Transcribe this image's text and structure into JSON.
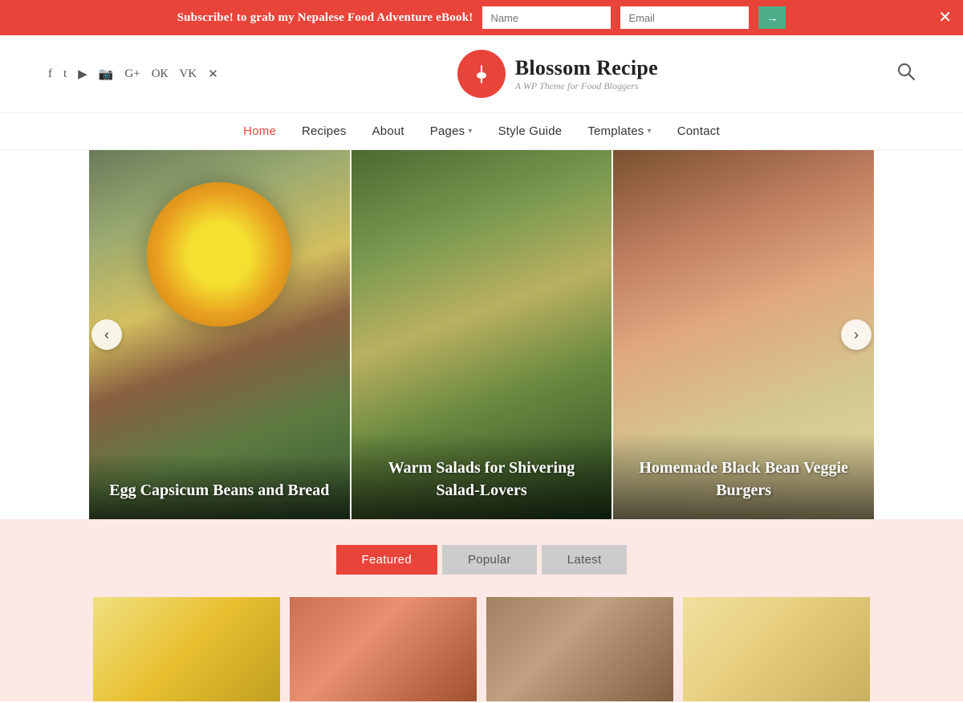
{
  "topBanner": {
    "text": "Subscribe! to grab my Nepalese Food Adventure eBook!",
    "namePlaceholder": "Name",
    "emailPlaceholder": "Email",
    "submitArrow": "→",
    "closeIcon": "✕"
  },
  "header": {
    "logoIcon": "🍴",
    "siteTitle": "Blossom Recipe",
    "siteTagline": "A WP Theme for Food Bloggers",
    "searchIcon": "🔍",
    "socialIcons": [
      {
        "name": "facebook-icon",
        "symbol": "f"
      },
      {
        "name": "twitter-icon",
        "symbol": "t"
      },
      {
        "name": "youtube-icon",
        "symbol": "▶"
      },
      {
        "name": "instagram-icon",
        "symbol": "📷"
      },
      {
        "name": "googleplus-icon",
        "symbol": "G+"
      },
      {
        "name": "odnoklassniki-icon",
        "symbol": "ОК"
      },
      {
        "name": "vk-icon",
        "symbol": "VK"
      },
      {
        "name": "xing-icon",
        "symbol": "✕"
      }
    ]
  },
  "nav": {
    "items": [
      {
        "label": "Home",
        "active": true,
        "hasDropdown": false
      },
      {
        "label": "Recipes",
        "active": false,
        "hasDropdown": false
      },
      {
        "label": "About",
        "active": false,
        "hasDropdown": false
      },
      {
        "label": "Pages",
        "active": false,
        "hasDropdown": true
      },
      {
        "label": "Style Guide",
        "active": false,
        "hasDropdown": false
      },
      {
        "label": "Templates",
        "active": false,
        "hasDropdown": true
      },
      {
        "label": "Contact",
        "active": false,
        "hasDropdown": false
      }
    ]
  },
  "carousel": {
    "prevIcon": "‹",
    "nextIcon": "›",
    "slides": [
      {
        "title": "Egg Capsicum Beans and Bread"
      },
      {
        "title": "Warm Salads for Shivering Salad-Lovers"
      },
      {
        "title": "Homemade Black Bean Veggie Burgers"
      }
    ]
  },
  "featuredSection": {
    "tabs": [
      {
        "label": "Featured",
        "active": true
      },
      {
        "label": "Popular",
        "active": false
      },
      {
        "label": "Latest",
        "active": false
      }
    ]
  }
}
